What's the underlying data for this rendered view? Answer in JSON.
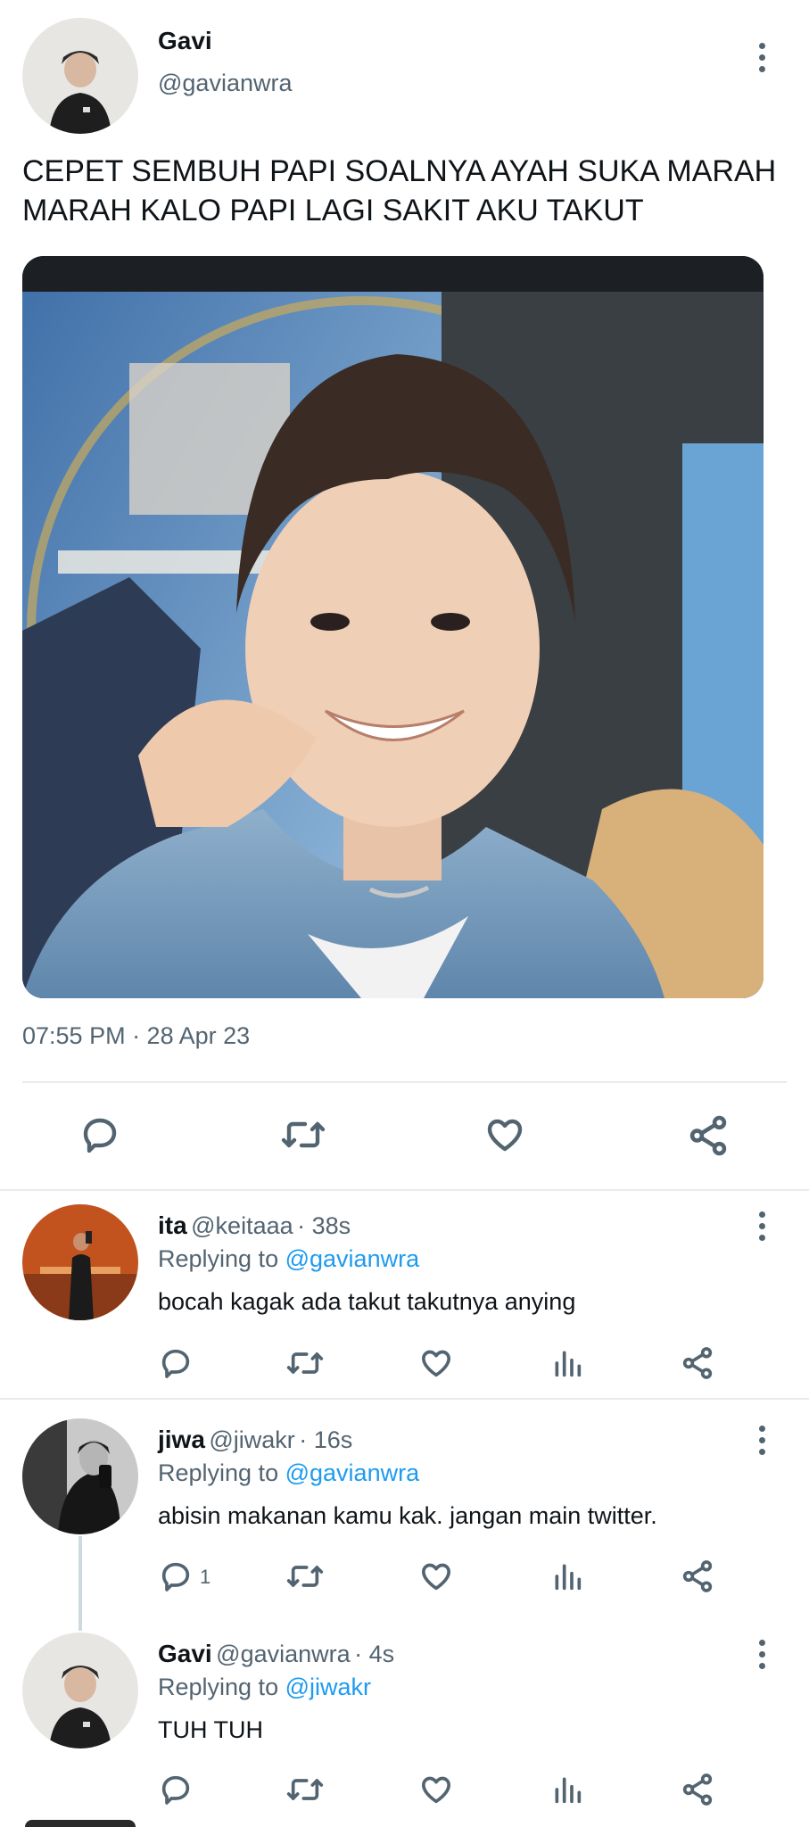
{
  "main_tweet": {
    "display_name": "Gavi",
    "handle": "@gavianwra",
    "text": "CEPET SEMBUH PAPI SOALNYA AYAH SUKA MARAH MARAH KALO PAPI LAGI SAKIT AKU TAKUT",
    "timestamp": "07:55 PM · 28 Apr 23",
    "actions": [
      "reply-icon",
      "retweet-icon",
      "like-icon",
      "share-icon"
    ]
  },
  "replies": [
    {
      "display_name": "ita",
      "handle": "@keitaaa",
      "time": "· 38s",
      "replying_prefix": "Replying to",
      "replying_to": "@gavianwra",
      "text": "bocah kagak ada takut takutnya anying",
      "reply_count": ""
    },
    {
      "display_name": "jiwa",
      "handle": "@jiwakr",
      "time": "· 16s",
      "replying_prefix": "Replying to",
      "replying_to": "@gavianwra",
      "text": "abisin makanan kamu kak. jangan main twitter.",
      "reply_count": "1"
    },
    {
      "display_name": "Gavi",
      "handle": "@gavianwra",
      "time": "· 4s",
      "replying_prefix": "Replying to",
      "replying_to": "@jiwakr",
      "text": "TUH TUH",
      "reply_count": ""
    }
  ],
  "colors": {
    "text": "#0f1419",
    "secondary": "#536471",
    "link": "#1d9bf0",
    "divider": "#e6ecf0"
  }
}
